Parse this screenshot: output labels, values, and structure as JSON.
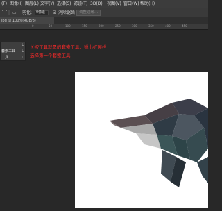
{
  "menubar": {
    "items": [
      "(F)",
      "图像(I)",
      "图层(L)",
      "文字(Y)",
      "选择(S)",
      "滤镜(T)",
      "3D(D)",
      "视图(V)",
      "窗口(W)",
      "帮助(H)"
    ]
  },
  "options": {
    "feather_label": "羽化:",
    "feather_value": "0像素",
    "antialias_label": "消除锯齿",
    "adjust_edge_button": "调整边缘...",
    "select_tool_icon": "lasso-icon"
  },
  "document": {
    "tab_label": "jpg @ 100%(RGB/8)"
  },
  "ruler": {
    "ticks": [
      "0",
      "50",
      "100",
      "150",
      "200",
      "250",
      "300",
      "350",
      "400",
      "450"
    ]
  },
  "tools": {
    "items": [
      {
        "label": "",
        "key": "L"
      },
      {
        "label": "套索工具",
        "key": "L"
      },
      {
        "label": "工具",
        "key": "L"
      }
    ]
  },
  "annotation": {
    "line1": "长按工具就是的套索工具，弹出扩展栏",
    "line2": "选择第一个套索工具",
    "color": "#ff2a2a"
  },
  "colors": {
    "background": "#282828",
    "canvas": "#ffffff",
    "panel": "#3e3e3e"
  }
}
